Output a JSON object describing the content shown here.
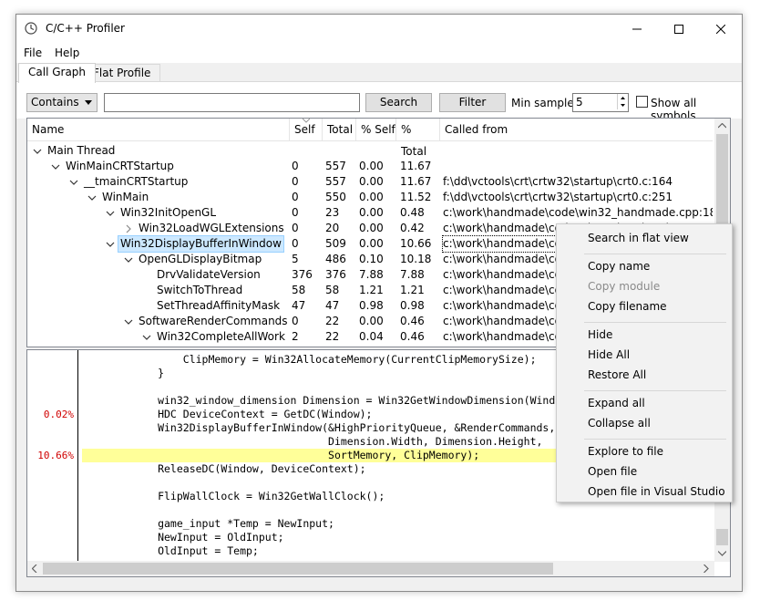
{
  "window": {
    "title": "C/C++ Profiler"
  },
  "menu": [
    {
      "label": "File"
    },
    {
      "label": "Help"
    }
  ],
  "tabs": [
    {
      "label": "Call Graph"
    },
    {
      "label": "Flat Profile"
    }
  ],
  "toolbar": {
    "filter_mode": "Contains",
    "search_value": "",
    "search_label": "Search",
    "filter_label": "Filter",
    "min_samples_label": "Min samples:",
    "min_samples_value": "5",
    "show_all_label": "Show all symbols"
  },
  "tree": {
    "columns": [
      "Name",
      "Self",
      "Total",
      "% Self",
      "% Total",
      "Called from"
    ],
    "rows": [
      {
        "name": "Main Thread",
        "self": "",
        "total": "",
        "pself": "",
        "ptotal": "",
        "from": ""
      },
      {
        "name": "WinMainCRTStartup",
        "self": "0",
        "total": "557",
        "pself": "0.00",
        "ptotal": "11.67",
        "from": ""
      },
      {
        "name": "__tmainCRTStartup",
        "self": "0",
        "total": "557",
        "pself": "0.00",
        "ptotal": "11.67",
        "from": "f:\\dd\\vctools\\crt\\crtw32\\startup\\crt0.c:164"
      },
      {
        "name": "WinMain",
        "self": "0",
        "total": "550",
        "pself": "0.00",
        "ptotal": "11.52",
        "from": "f:\\dd\\vctools\\crt\\crtw32\\startup\\crt0.c:251"
      },
      {
        "name": "Win32InitOpenGL",
        "self": "0",
        "total": "23",
        "pself": "0.00",
        "ptotal": "0.48",
        "from": "c:\\work\\handmade\\code\\win32_handmade.cpp:1879"
      },
      {
        "name": "Win32LoadWGLExtensions",
        "self": "0",
        "total": "20",
        "pself": "0.00",
        "ptotal": "0.42",
        "from": "c:\\work\\handmade\\code\\win32_handmade.cpp:999"
      },
      {
        "name": "Win32DisplayBufferInWindow",
        "self": "0",
        "total": "509",
        "pself": "0.00",
        "ptotal": "10.66",
        "from": "c:\\work\\handmade\\code"
      },
      {
        "name": "OpenGLDisplayBitmap",
        "self": "5",
        "total": "486",
        "pself": "0.10",
        "ptotal": "10.18",
        "from": "c:\\work\\handmade\\code"
      },
      {
        "name": "DrvValidateVersion",
        "self": "376",
        "total": "376",
        "pself": "7.88",
        "ptotal": "7.88",
        "from": "c:\\work\\handmade\\code"
      },
      {
        "name": "SwitchToThread",
        "self": "58",
        "total": "58",
        "pself": "1.21",
        "ptotal": "1.21",
        "from": "c:\\work\\handmade\\code"
      },
      {
        "name": "SetThreadAffinityMask",
        "self": "47",
        "total": "47",
        "pself": "0.98",
        "ptotal": "0.98",
        "from": "c:\\work\\handmade\\code"
      },
      {
        "name": "SoftwareRenderCommands",
        "self": "0",
        "total": "22",
        "pself": "0.00",
        "ptotal": "0.46",
        "from": "c:\\work\\handmade\\code"
      },
      {
        "name": "Win32CompleteAllWork",
        "self": "2",
        "total": "22",
        "pself": "0.04",
        "ptotal": "0.46",
        "from": "c:\\work\\handmade\\code"
      }
    ]
  },
  "code": {
    "lines": [
      {
        "pct": "",
        "text": "                ClipMemory = Win32AllocateMemory(CurrentClipMemorySize);"
      },
      {
        "pct": "",
        "text": "            }"
      },
      {
        "pct": "",
        "text": ""
      },
      {
        "pct": "",
        "text": "            win32_window_dimension Dimension = Win32GetWindowDimension(Window);"
      },
      {
        "pct": "0.02%",
        "text": "            HDC DeviceContext = GetDC(Window);"
      },
      {
        "pct": "",
        "text": "            Win32DisplayBufferInWindow(&HighPriorityQueue, &RenderCommands, DeviceContext,"
      },
      {
        "pct": "",
        "text": "                                       Dimension.Width, Dimension.Height,"
      },
      {
        "pct": "10.66%",
        "text": "                                       SortMemory, ClipMemory);"
      },
      {
        "pct": "",
        "text": "            ReleaseDC(Window, DeviceContext);"
      },
      {
        "pct": "",
        "text": ""
      },
      {
        "pct": "",
        "text": "            FlipWallClock = Win32GetWallClock();"
      },
      {
        "pct": "",
        "text": ""
      },
      {
        "pct": "",
        "text": "            game_input *Temp = NewInput;"
      },
      {
        "pct": "",
        "text": "            NewInput = OldInput;"
      },
      {
        "pct": "",
        "text": "            OldInput = Temp;"
      }
    ]
  },
  "context_menu": {
    "items": [
      {
        "label": "Search in flat view",
        "enabled": true
      },
      {
        "label": "Copy name",
        "enabled": true
      },
      {
        "label": "Copy module",
        "enabled": false
      },
      {
        "label": "Copy filename",
        "enabled": true
      },
      {
        "label": "Hide",
        "enabled": true
      },
      {
        "label": "Hide All",
        "enabled": true
      },
      {
        "label": "Restore All",
        "enabled": true
      },
      {
        "label": "Expand all",
        "enabled": true
      },
      {
        "label": "Collapse all",
        "enabled": true
      },
      {
        "label": "Explore to file",
        "enabled": true
      },
      {
        "label": "Open file",
        "enabled": true
      },
      {
        "label": "Open file in Visual Studio",
        "enabled": true
      }
    ]
  },
  "colors": {
    "selection": "#cce8ff",
    "selection_border": "#99d1ff",
    "highlight": "#ffff99",
    "percent": "#d00000"
  }
}
